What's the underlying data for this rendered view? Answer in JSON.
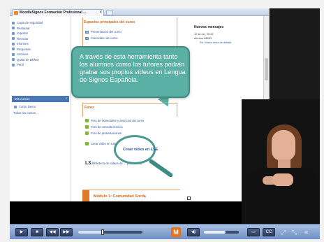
{
  "browser_tab": {
    "title": "MoodleSignos Formación Profesional ..."
  },
  "left_nav": {
    "items": [
      "Copia de seguridad",
      "Restaurar",
      "Importar",
      "Reiniciar",
      "Informes",
      "Preguntas",
      "Archivos",
      "Quitar de DEMO",
      "Perfil"
    ],
    "my_courses_header": "Mis cursos",
    "course_item": "Curso Demo",
    "all_courses_link": "Todos los cursos ..."
  },
  "center": {
    "section_title": "Espacios principales del curso",
    "resources": [
      "Presentación del curso",
      "Calendario de curso"
    ],
    "foros_title": "Foros",
    "foros_links": [
      "Foro de Novedades y anuncios del curso",
      "Foro de consulta técnica",
      "Foro de presentaciones",
      "Crear vídeo en LSE"
    ],
    "biblioteca_lead": "L3",
    "biblioteca_text": "Biblioteca de vídeos de ... profesores)",
    "module_title": "Módulo 1: Comunidad Sorda"
  },
  "right": {
    "news_title": "Nuevos mensajes",
    "news_date": "12 de oct, 09:15",
    "news_author": "Alumno DEMO",
    "news_link": "Re: Nuevo tema de debate"
  },
  "callout": {
    "text": "A través de esta herramienta tanto los alumnos como los tutores podrán grabar sus propios vídeos en Lengua de Signos Española."
  },
  "magnifier": {
    "label": "Crear vídeo en LSE"
  },
  "player": {
    "seek_progress": 0.38,
    "volume_level": 0.62,
    "logo_glyph": "M",
    "cc_label": "CC",
    "btn_play": "▶",
    "btn_stop": "■",
    "btn_rewind": "◀◀",
    "btn_forward": "▶▶",
    "btn_mute": "◀)",
    "btn_screen": "▭",
    "btn_fullscreen": "⤢",
    "btn_expand": "⤡",
    "btn_menu": "≡"
  }
}
